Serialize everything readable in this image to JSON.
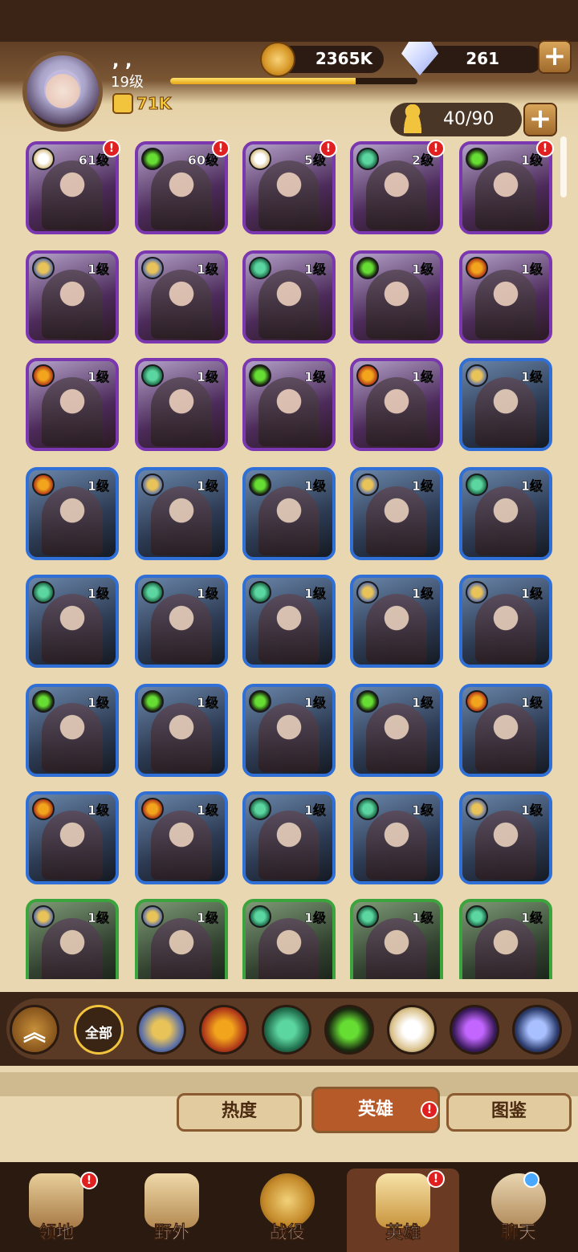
{
  "player": {
    "name": ", ,",
    "level": "19级",
    "power": "71K",
    "xp_percent": 75
  },
  "resources": {
    "gold": "2365K",
    "gems": "261",
    "hero_capacity": "40/90"
  },
  "heroes": [
    {
      "level": "61级",
      "frame": "purple",
      "faction": "celestial",
      "alert": true
    },
    {
      "level": "60级",
      "frame": "purple",
      "faction": "graveborn",
      "alert": true
    },
    {
      "level": "5级",
      "frame": "purple",
      "faction": "celestial",
      "alert": true
    },
    {
      "level": "2级",
      "frame": "purple",
      "faction": "wilder",
      "alert": true
    },
    {
      "level": "1级",
      "frame": "purple",
      "faction": "graveborn",
      "alert": true
    },
    {
      "level": "1级",
      "frame": "purple",
      "faction": "lightbearer",
      "alert": false
    },
    {
      "level": "1级",
      "frame": "purple",
      "faction": "lightbearer",
      "alert": false
    },
    {
      "level": "1级",
      "frame": "purple",
      "faction": "wilder",
      "alert": false
    },
    {
      "level": "1级",
      "frame": "purple",
      "faction": "graveborn",
      "alert": false
    },
    {
      "level": "1级",
      "frame": "purple",
      "faction": "maulers",
      "alert": false
    },
    {
      "level": "1级",
      "frame": "purple",
      "faction": "maulers",
      "alert": false
    },
    {
      "level": "1级",
      "frame": "purple",
      "faction": "wilder",
      "alert": false
    },
    {
      "level": "1级",
      "frame": "purple",
      "faction": "graveborn",
      "alert": false
    },
    {
      "level": "1级",
      "frame": "purple",
      "faction": "maulers",
      "alert": false
    },
    {
      "level": "1级",
      "frame": "blue",
      "faction": "lightbearer",
      "alert": false
    },
    {
      "level": "1级",
      "frame": "blue",
      "faction": "maulers",
      "alert": false
    },
    {
      "level": "1级",
      "frame": "blue",
      "faction": "lightbearer",
      "alert": false
    },
    {
      "level": "1级",
      "frame": "blue",
      "faction": "graveborn",
      "alert": false
    },
    {
      "level": "1级",
      "frame": "blue",
      "faction": "lightbearer",
      "alert": false
    },
    {
      "level": "1级",
      "frame": "blue",
      "faction": "wilder",
      "alert": false
    },
    {
      "level": "1级",
      "frame": "blue",
      "faction": "wilder",
      "alert": false
    },
    {
      "level": "1级",
      "frame": "blue",
      "faction": "wilder",
      "alert": false
    },
    {
      "level": "1级",
      "frame": "blue",
      "faction": "wilder",
      "alert": false
    },
    {
      "level": "1级",
      "frame": "blue",
      "faction": "lightbearer",
      "alert": false
    },
    {
      "level": "1级",
      "frame": "blue",
      "faction": "lightbearer",
      "alert": false
    },
    {
      "level": "1级",
      "frame": "blue",
      "faction": "graveborn",
      "alert": false
    },
    {
      "level": "1级",
      "frame": "blue",
      "faction": "graveborn",
      "alert": false
    },
    {
      "level": "1级",
      "frame": "blue",
      "faction": "graveborn",
      "alert": false
    },
    {
      "level": "1级",
      "frame": "blue",
      "faction": "graveborn",
      "alert": false
    },
    {
      "level": "1级",
      "frame": "blue",
      "faction": "maulers",
      "alert": false
    },
    {
      "level": "1级",
      "frame": "blue",
      "faction": "maulers",
      "alert": false
    },
    {
      "level": "1级",
      "frame": "blue",
      "faction": "maulers",
      "alert": false
    },
    {
      "level": "1级",
      "frame": "blue",
      "faction": "wilder",
      "alert": false
    },
    {
      "level": "1级",
      "frame": "blue",
      "faction": "wilder",
      "alert": false
    },
    {
      "level": "1级",
      "frame": "blue",
      "faction": "lightbearer",
      "alert": false
    },
    {
      "level": "1级",
      "frame": "green",
      "faction": "lightbearer",
      "alert": false
    },
    {
      "level": "1级",
      "frame": "green",
      "faction": "lightbearer",
      "alert": false
    },
    {
      "level": "1级",
      "frame": "green",
      "faction": "wilder",
      "alert": false
    },
    {
      "level": "1级",
      "frame": "green",
      "faction": "wilder",
      "alert": false
    },
    {
      "level": "1级",
      "frame": "green",
      "faction": "wilder",
      "alert": false
    }
  ],
  "factions": {
    "lightbearer": {
      "color": "#e8c35a",
      "inner": "#5a6fa8"
    },
    "maulers": {
      "color": "#f2a51c",
      "inner": "#b03a1a"
    },
    "wilder": {
      "color": "#5cd6a0",
      "inner": "#1f6a4a"
    },
    "graveborn": {
      "color": "#66dd33",
      "inner": "#1a2a10"
    },
    "celestial": {
      "color": "#ffffff",
      "inner": "#d9c08a"
    },
    "hypogean": {
      "color": "#c266ff",
      "inner": "#3a1a5a"
    },
    "dimensional": {
      "color": "#a8c0ff",
      "inner": "#2a3a6a"
    }
  },
  "filter_bar": {
    "all_label": "全部",
    "buttons": [
      "collapse",
      "all",
      "lightbearer",
      "maulers",
      "wilder",
      "graveborn",
      "celestial",
      "hypogean",
      "dimensional"
    ]
  },
  "tabs": {
    "popularity": "热度",
    "heroes": "英雄",
    "codex": "图鉴"
  },
  "nav": {
    "territory": "领地",
    "wild": "野外",
    "campaign": "战役",
    "heroes": "英雄",
    "chat": "聊天",
    "alert_mark": "!"
  }
}
